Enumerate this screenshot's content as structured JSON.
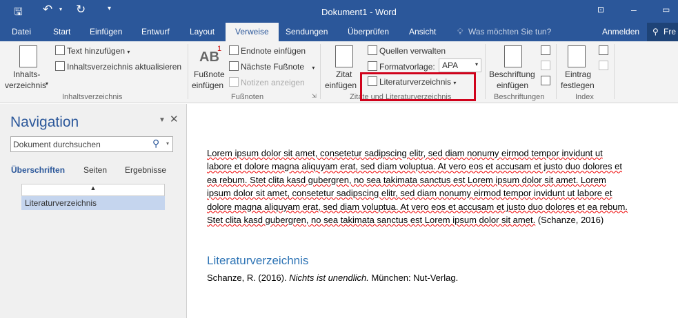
{
  "window": {
    "title": "Dokument1 - Word"
  },
  "tabs": [
    "Datei",
    "Start",
    "Einfügen",
    "Entwurf",
    "Layout",
    "Verweise",
    "Sendungen",
    "Überprüfen",
    "Ansicht"
  ],
  "tell_me": "Was möchten Sie tun?",
  "signin": "Anmelden",
  "share": "Fre",
  "ribbon": {
    "toc": {
      "button_line1": "Inhalts-",
      "button_line2": "verzeichnis",
      "add_text": "Text hinzufügen",
      "update": "Inhaltsverzeichnis aktualisieren",
      "group": "Inhaltsverzeichnis"
    },
    "footnotes": {
      "insert_line1": "Fußnote",
      "insert_line2": "einfügen",
      "ab": "AB",
      "sup": "1",
      "endnote": "Endnote einfügen",
      "next": "Nächste Fußnote",
      "show": "Notizen anzeigen",
      "group": "Fußnoten"
    },
    "citations": {
      "insert_line1": "Zitat",
      "insert_line2": "einfügen",
      "manage": "Quellen verwalten",
      "style_label": "Formatvorlage:",
      "style_value": "APA",
      "bibliography": "Literaturverzeichnis",
      "group": "Zitate und Literaturverzeichnis"
    },
    "captions": {
      "insert_line1": "Beschriftung",
      "insert_line2": "einfügen",
      "group": "Beschriftungen"
    },
    "index": {
      "mark_line1": "Eintrag",
      "mark_line2": "festlegen",
      "group": "Index"
    },
    "highlight_color": "#d0021b"
  },
  "nav": {
    "title": "Navigation",
    "search_placeholder": "Dokument durchsuchen",
    "tabs": [
      "Überschriften",
      "Seiten",
      "Ergebnisse"
    ],
    "headings": [
      "Literaturverzeichnis"
    ]
  },
  "doc": {
    "body": "Lorem ipsum dolor sit amet, consetetur sadipscing elitr, sed diam nonumy eirmod tempor invidunt ut labore et dolore magna aliquyam erat, sed diam voluptua. At vero eos et accusam et justo duo dolores et ea rebum. Stet clita kasd gubergren, no sea takimata sanctus est Lorem ipsum dolor sit amet. Lorem ipsum dolor sit amet, consetetur sadipscing elitr, sed diam nonumy eirmod tempor invidunt ut labore et dolore magna aliquyam erat, sed diam voluptua. At vero eos et accusam et justo duo dolores et ea rebum. Stet clita kasd gubergren, no sea takimata sanctus est Lorem ipsum dolor sit amet.",
    "citation": " (Schanze, 2016)",
    "heading": "Literaturverzeichnis",
    "ref_author": "Schanze, R. (2016). ",
    "ref_title": "Nichts ist unendlich.",
    "ref_pub": " München: Nut-Verlag."
  }
}
